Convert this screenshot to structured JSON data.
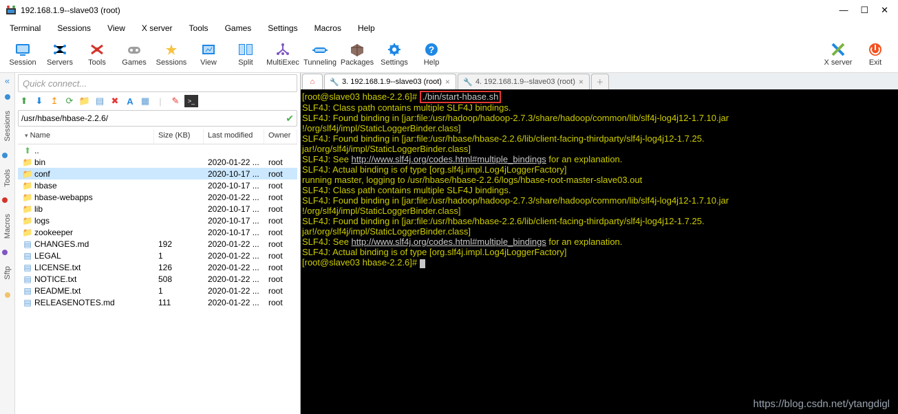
{
  "window": {
    "title": "192.168.1.9--slave03 (root)"
  },
  "menu": [
    "Terminal",
    "Sessions",
    "View",
    "X server",
    "Tools",
    "Games",
    "Settings",
    "Macros",
    "Help"
  ],
  "toolbar": [
    {
      "id": "session",
      "label": "Session",
      "color": "#1e88e5"
    },
    {
      "id": "servers",
      "label": "Servers",
      "color": "#1e88e5"
    },
    {
      "id": "tools",
      "label": "Tools",
      "color": "#d4342a"
    },
    {
      "id": "games",
      "label": "Games",
      "color": "#9e9e9e"
    },
    {
      "id": "sessions",
      "label": "Sessions",
      "color": "#f6c342"
    },
    {
      "id": "view",
      "label": "View",
      "color": "#1e88e5"
    },
    {
      "id": "split",
      "label": "Split",
      "color": "#1e88e5"
    },
    {
      "id": "multiexec",
      "label": "MultiExec",
      "color": "#7e57c2"
    },
    {
      "id": "tunneling",
      "label": "Tunneling",
      "color": "#1e88e5"
    },
    {
      "id": "packages",
      "label": "Packages",
      "color": "#8d6e63"
    },
    {
      "id": "settings",
      "label": "Settings",
      "color": "#1e88e5"
    },
    {
      "id": "help",
      "label": "Help",
      "color": "#1e88e5"
    }
  ],
  "toolbar_right": [
    {
      "id": "xserver",
      "label": "X server"
    },
    {
      "id": "exit",
      "label": "Exit"
    }
  ],
  "rail_tabs": [
    "Sessions",
    "Tools",
    "Macros",
    "Sftp"
  ],
  "quick_connect_placeholder": "Quick connect...",
  "path": "/usr/hbase/hbase-2.2.6/",
  "columns": {
    "name": "Name",
    "size": "Size (KB)",
    "mod": "Last modified",
    "owner": "Owner"
  },
  "files": [
    {
      "type": "up",
      "name": "..",
      "size": "",
      "mod": "",
      "owner": ""
    },
    {
      "type": "dir",
      "name": "bin",
      "size": "",
      "mod": "2020-01-22 ...",
      "owner": "root"
    },
    {
      "type": "dir",
      "name": "conf",
      "size": "",
      "mod": "2020-10-17 ...",
      "owner": "root",
      "selected": true
    },
    {
      "type": "dir",
      "name": "hbase",
      "size": "",
      "mod": "2020-10-17 ...",
      "owner": "root"
    },
    {
      "type": "dir",
      "name": "hbase-webapps",
      "size": "",
      "mod": "2020-01-22 ...",
      "owner": "root"
    },
    {
      "type": "dir",
      "name": "lib",
      "size": "",
      "mod": "2020-10-17 ...",
      "owner": "root"
    },
    {
      "type": "dir",
      "name": "logs",
      "size": "",
      "mod": "2020-10-17 ...",
      "owner": "root"
    },
    {
      "type": "dir",
      "name": "zookeeper",
      "size": "",
      "mod": "2020-10-17 ...",
      "owner": "root"
    },
    {
      "type": "file",
      "name": "CHANGES.md",
      "size": "192",
      "mod": "2020-01-22 ...",
      "owner": "root"
    },
    {
      "type": "file",
      "name": "LEGAL",
      "size": "1",
      "mod": "2020-01-22 ...",
      "owner": "root"
    },
    {
      "type": "file",
      "name": "LICENSE.txt",
      "size": "126",
      "mod": "2020-01-22 ...",
      "owner": "root"
    },
    {
      "type": "file",
      "name": "NOTICE.txt",
      "size": "508",
      "mod": "2020-01-22 ...",
      "owner": "root"
    },
    {
      "type": "file",
      "name": "README.txt",
      "size": "1",
      "mod": "2020-01-22 ...",
      "owner": "root"
    },
    {
      "type": "file",
      "name": "RELEASENOTES.md",
      "size": "111",
      "mod": "2020-01-22 ...",
      "owner": "root"
    }
  ],
  "tabs": {
    "active": {
      "label": "3. 192.168.1.9--slave03 (root)"
    },
    "inactive": {
      "label": "4. 192.168.1.9--slave03 (root)"
    }
  },
  "terminal": {
    "prompt1_pre": "[root@slave03 hbase-2.2.6]# ",
    "cmd_highlight": "./bin/start-hbase.sh",
    "lines": [
      "SLF4J: Class path contains multiple SLF4J bindings.",
      "SLF4J: Found binding in [jar:file:/usr/hadoop/hadoop-2.7.3/share/hadoop/common/lib/slf4j-log4j12-1.7.10.jar",
      "!/org/slf4j/impl/StaticLoggerBinder.class]",
      "SLF4J: Found binding in [jar:file:/usr/hbase/hbase-2.2.6/lib/client-facing-thirdparty/slf4j-log4j12-1.7.25.",
      "jar!/org/slf4j/impl/StaticLoggerBinder.class]"
    ],
    "see1_pre": "SLF4J: See ",
    "see1_link": "http://www.slf4j.org/codes.html#multiple_bindings",
    "see1_post": " for an explanation.",
    "lines2": [
      "SLF4J: Actual binding is of type [org.slf4j.impl.Log4jLoggerFactory]",
      "running master, logging to /usr/hbase/hbase-2.2.6/logs/hbase-root-master-slave03.out",
      "SLF4J: Class path contains multiple SLF4J bindings.",
      "SLF4J: Found binding in [jar:file:/usr/hadoop/hadoop-2.7.3/share/hadoop/common/lib/slf4j-log4j12-1.7.10.jar",
      "!/org/slf4j/impl/StaticLoggerBinder.class]",
      "SLF4J: Found binding in [jar:file:/usr/hbase/hbase-2.2.6/lib/client-facing-thirdparty/slf4j-log4j12-1.7.25.",
      "jar!/org/slf4j/impl/StaticLoggerBinder.class]"
    ],
    "see2_pre": "SLF4J: See ",
    "see2_link": "http://www.slf4j.org/codes.html#multiple_bindings",
    "see2_post": " for an explanation.",
    "lines3": [
      "SLF4J: Actual binding is of type [org.slf4j.impl.Log4jLoggerFactory]"
    ],
    "prompt2": "[root@slave03 hbase-2.2.6]# "
  },
  "watermark": "https://blog.csdn.net/ytangdigl"
}
